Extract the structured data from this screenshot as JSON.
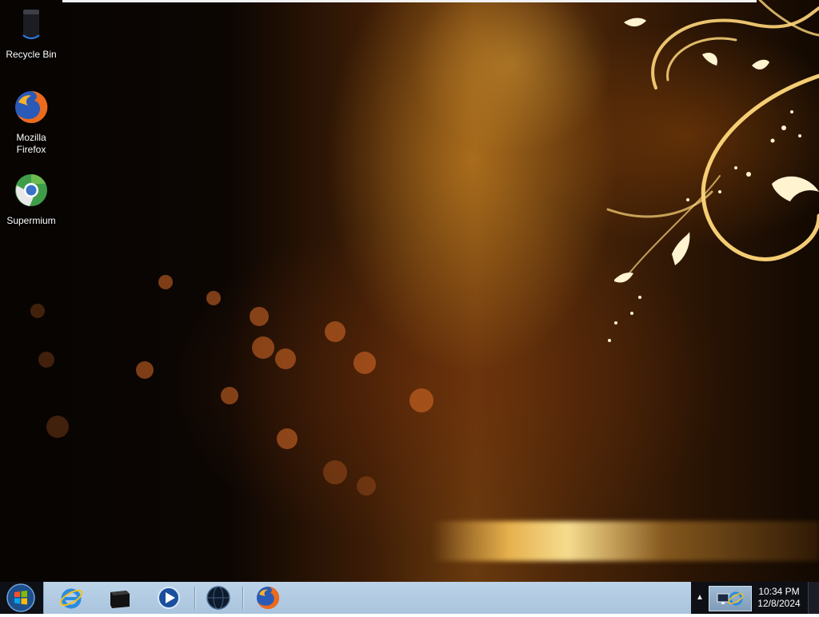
{
  "desktop": {
    "icons": [
      {
        "label": "Recycle Bin",
        "icon": "recycle-bin-icon"
      },
      {
        "label": "Mozilla Firefox",
        "icon": "firefox-icon"
      },
      {
        "label": "Supermium",
        "icon": "supermium-icon"
      }
    ]
  },
  "taskbar": {
    "start_icon": "windows-logo-icon",
    "pinned": [
      {
        "name": "internet-explorer",
        "icon": "internet-explorer-icon"
      },
      {
        "name": "black-folder-app",
        "icon": "black-box-icon"
      },
      {
        "name": "windows-media-player",
        "icon": "media-player-icon"
      },
      {
        "name": "globe-app",
        "icon": "globe-icon"
      },
      {
        "name": "firefox",
        "icon": "firefox-icon"
      }
    ],
    "accent_color": "#a9c4dd"
  },
  "tray": {
    "overflow_icon": "chevron-up-icon",
    "network_icon": "network-ie-icon",
    "time": "10:34 PM",
    "date": "12/8/2024"
  }
}
